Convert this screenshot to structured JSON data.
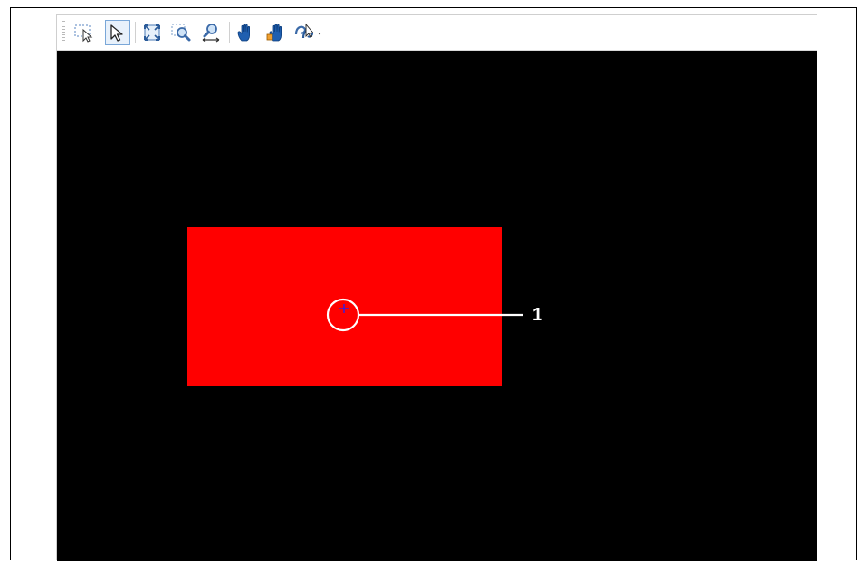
{
  "toolbar": {
    "tools": [
      {
        "icon": "region-select-icon"
      },
      {
        "icon": "select-pointer-icon",
        "active": true
      },
      {
        "icon": "fit-to-window-icon"
      },
      {
        "icon": "zoom-area-icon"
      },
      {
        "icon": "zoom-width-icon"
      },
      {
        "icon": "pan-hand-icon"
      },
      {
        "icon": "pan-image-hand-icon"
      },
      {
        "icon": "transform-dropdown-icon"
      }
    ]
  },
  "canvas": {
    "background_color": "#000000",
    "shape_color": "#ff0000",
    "marker_color": "#2020ff"
  },
  "callout": {
    "label": "1",
    "color": "#ffffff"
  }
}
